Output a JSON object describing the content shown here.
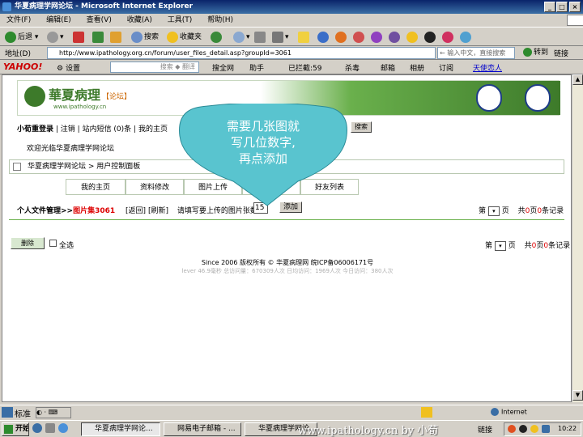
{
  "window": {
    "title": "华夏病理学网论坛 - Microsoft Internet Explorer"
  },
  "menu": [
    "文件(F)",
    "编辑(E)",
    "查看(V)",
    "收藏(A)",
    "工具(T)",
    "帮助(H)"
  ],
  "toolbar": {
    "back": "后退",
    "search": "搜索",
    "favorites": "收藏夹"
  },
  "address": {
    "label": "地址(D)",
    "url": "http://www.ipathology.org.cn/forum/user_files_detail.asp?groupId=3061",
    "search_placeholder": "← 输入中文，直接搜索",
    "go": "转到",
    "links": "链接"
  },
  "yahoo_bar": {
    "logo": "YAHOO!",
    "settings": "设置",
    "search_input": "搜索 ◆ 翻译",
    "site_search": "搜全网",
    "helper": "助手",
    "blocked": "已拦截:59",
    "antivirus": "杀毒",
    "mail": "邮箱",
    "album": "相册",
    "subscribe": "订阅",
    "dating": "天使恋人"
  },
  "forum": {
    "logo_cn": "華夏病理",
    "logo_tag": "【论坛】",
    "logo_url": "www.ipathology.cn",
    "nav": [
      "小荀重登录",
      "注销",
      "站内短信 (0)条",
      "我的主页"
    ],
    "search_button": "搜索",
    "welcome": "欢迎光临华夏病理学网论坛",
    "breadcrumb": "华夏病理学网论坛 > 用户控制面板",
    "tabs": [
      "我的主页",
      "资料修改",
      "图片上传",
      "...改",
      "好友列表"
    ],
    "files_title": "个人文件管理>>",
    "album_name": "图片集3061",
    "back_link": "[返回]",
    "refresh_link": "[刷新]",
    "upload_prompt": "请填写要上传的图片张数：",
    "upload_count": "15",
    "add_button": "添加",
    "page_prefix": "第",
    "page_suffix": "页",
    "page_total_text": "共0页0条记录",
    "page_total_0": "共",
    "page_total_1": "0",
    "page_total_2": "页",
    "page_total_3": "0",
    "page_total_4": "条记录",
    "delete_button": "删除",
    "select_all": "全选",
    "footer_copyright": "Since 2006 版权所有 © 华夏病理网 皖ICP备06006171号",
    "footer_stats": "lever 46.9毫秒 总访问量：670309人次 日均访问：1969人次 今日访问：380人次"
  },
  "callout": {
    "lines": [
      "需要几张图就",
      "写几位数字,",
      "再点添加"
    ]
  },
  "status": {
    "zone": "Internet",
    "ime": "标准"
  },
  "taskbar": {
    "start": "开始",
    "tasks": [
      "华夏病理学网论...",
      "网易电子邮箱 - ...",
      "华夏病理学网论..."
    ],
    "watermark": "www.ipathology.cn  by 小荀",
    "links": "链接",
    "clock": "10:22"
  },
  "colors": {
    "accent": "#3d7a2a",
    "callout": "#59c4cf",
    "red": "#dd0000"
  }
}
